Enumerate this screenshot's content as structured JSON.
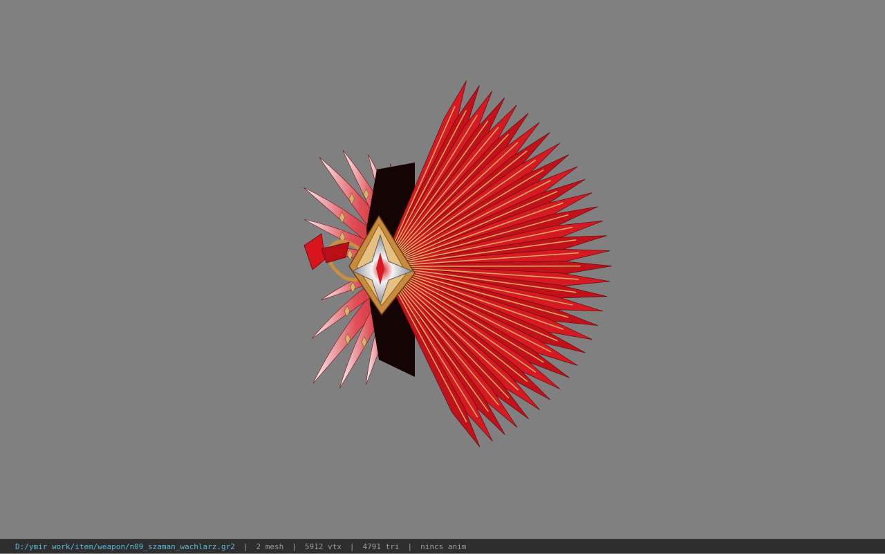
{
  "viewer": {
    "background_color": "#808080",
    "model": {
      "name": "red feather fan weapon",
      "colors": {
        "feather_red": "#c8141c",
        "feather_dark": "#5a0508",
        "feather_tip": "#f2eeee",
        "gold_trim": "#d4a055",
        "jewel_silver": "#e8e8ea"
      }
    }
  },
  "status_bar": {
    "file_path": "D:/ymir work/item/weapon/n09_szaman_wachlarz.gr2",
    "separator": "|",
    "mesh": "2 mesh",
    "vertices": "5912 vtx",
    "triangles": "4791 tri",
    "animation": "nincs anim",
    "path_color": "#5fb7d6",
    "bar_color": "#2e2e2e"
  }
}
